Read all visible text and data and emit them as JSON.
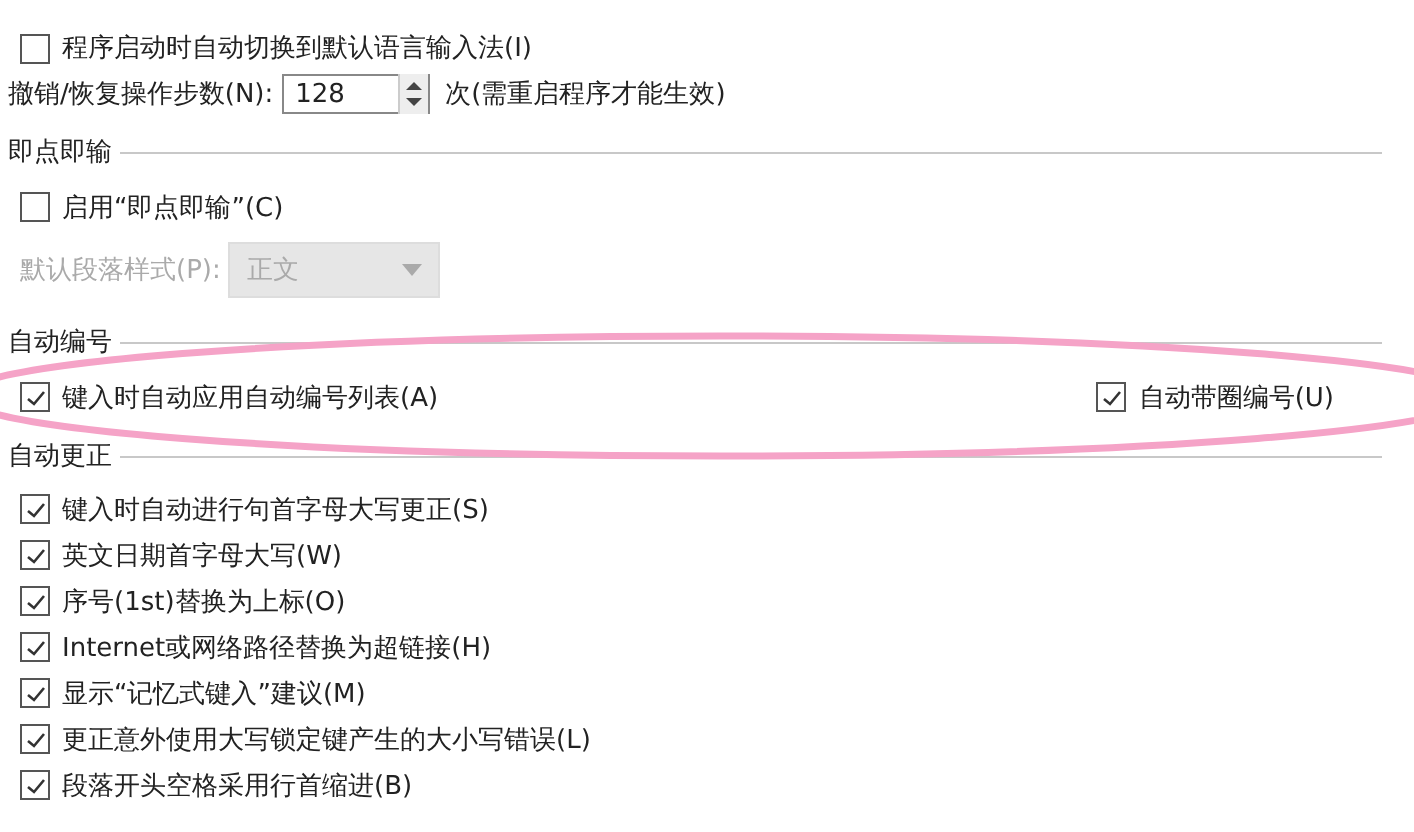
{
  "general": {
    "items": [
      {
        "label": "程序启动时自动切换到默认语言输入法(I)",
        "checked": false
      }
    ],
    "undo": {
      "label": "撤销/恢复操作步数(N):",
      "value": "128",
      "note": "次(需重启程序才能生效)"
    }
  },
  "sections": [
    {
      "title": "即点即输",
      "rows": [
        {
          "kind": "checkbox",
          "items": [
            {
              "label": "启用“即点即输”(C)",
              "checked": false
            }
          ]
        },
        {
          "kind": "select",
          "label": "默认段落样式(P):",
          "value": "正文",
          "disabled": true
        }
      ]
    },
    {
      "title": "自动编号",
      "rows": [
        {
          "kind": "checkbox",
          "items": [
            {
              "label": "键入时自动应用自动编号列表(A)",
              "checked": true
            },
            {
              "label": "自动带圈编号(U)",
              "checked": true
            }
          ]
        }
      ]
    },
    {
      "title": "自动更正",
      "rows": [
        {
          "kind": "checkbox",
          "items": [
            {
              "label": "键入时自动进行句首字母大写更正(S)",
              "checked": true
            }
          ]
        },
        {
          "kind": "checkbox",
          "items": [
            {
              "label": "英文日期首字母大写(W)",
              "checked": true
            }
          ]
        },
        {
          "kind": "checkbox",
          "items": [
            {
              "label": "序号(1st)替换为上标(O)",
              "checked": true
            }
          ]
        },
        {
          "kind": "checkbox",
          "items": [
            {
              "label": "Internet或网络路径替换为超链接(H)",
              "checked": true
            }
          ]
        },
        {
          "kind": "checkbox",
          "items": [
            {
              "label": "显示“记忆式键入”建议(M)",
              "checked": true
            }
          ]
        },
        {
          "kind": "checkbox",
          "items": [
            {
              "label": "更正意外使用大写锁定键产生的大小写错误(L)",
              "checked": true
            }
          ]
        },
        {
          "kind": "checkbox",
          "items": [
            {
              "label": "段落开头空格采用行首缩进(B)",
              "checked": true
            }
          ]
        }
      ]
    }
  ]
}
